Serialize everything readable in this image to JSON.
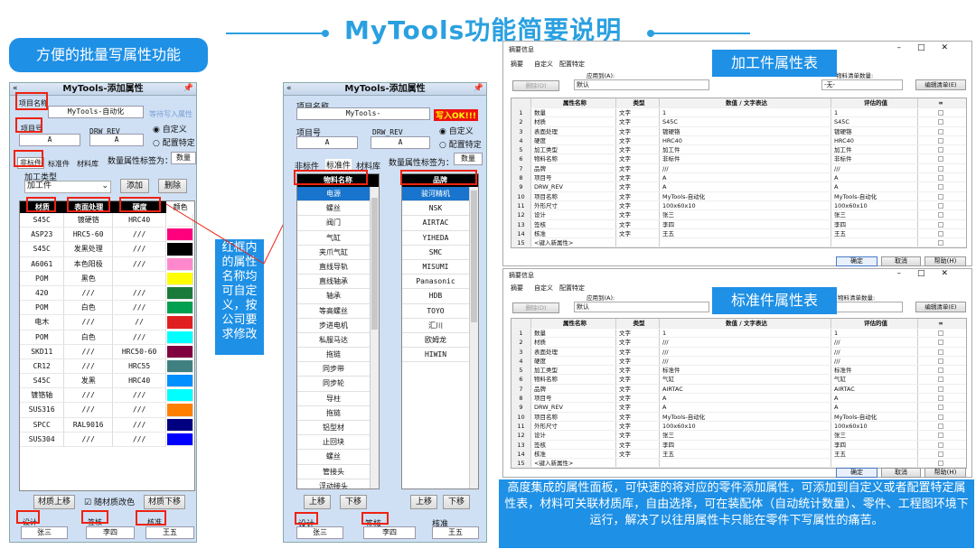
{
  "page_title": "MyTools功能简要说明",
  "left_badge": "方便的批量写属性功能",
  "callout": "红框内的属性名称均可自定义，按公司要求修改",
  "bottom_text": "高度集成的属性面板，可快速的将对应的零件添加属性，可添加到自定义或者配置特定属性表，材料可关联材质库，自由选择，可在装配体（自动统计数量）、零件、工程图环境下运行，解决了以往用属性卡只能在零件下写属性的痛苦。",
  "panel1": {
    "title": "MyTools-添加属性",
    "name_label": "项目名称",
    "name_value": "MyTools-自动化",
    "write_hint": "等待写入属性",
    "num_label": "项目号",
    "num_value": "A",
    "drw_label": "DRW_REV",
    "drw_value": "A",
    "radio_custom": "自定义",
    "radio_config": "配置特定",
    "tabs": [
      "非标件",
      "标准件",
      "材料库"
    ],
    "qty_label": "数量属性标签为：",
    "qty_value": "数量",
    "type_label": "加工类型",
    "type_value": "加工件",
    "add_btn": "添加",
    "del_btn": "删除",
    "cols": [
      "材质",
      "表面处理",
      "硬度",
      "颜色"
    ],
    "rows": [
      [
        "S45C",
        "镀硬铬",
        "HRC40",
        "#ffffff"
      ],
      [
        "ASP23",
        "HRC5-60",
        "///",
        "#ff007f"
      ],
      [
        "S45C",
        "发黑处理",
        "///",
        "#000000"
      ],
      [
        "A6061",
        "本色阳极",
        "///",
        "#ff88cc"
      ],
      [
        "POM",
        "黑色",
        "",
        "#ffff00"
      ],
      [
        "420",
        "///",
        "///",
        "#1a7a3a"
      ],
      [
        "POM",
        "白色",
        "///",
        "#00a050"
      ],
      [
        "电木",
        "///",
        "//",
        "#e02020"
      ],
      [
        "POM",
        "白色",
        "///",
        "#00ffff"
      ],
      [
        "SKD11",
        "///",
        "HRC50-60",
        "#800040"
      ],
      [
        "CR12",
        "///",
        "HRC55",
        "#408080"
      ],
      [
        "S45C",
        "发黑",
        "HRC40",
        "#0090ff"
      ],
      [
        "镀铬轴",
        "///",
        "///",
        "#00ffff"
      ],
      [
        "SUS316",
        "///",
        "///",
        "#ff8000"
      ],
      [
        "SPCC",
        "RAL9016",
        "///",
        "#000080"
      ],
      [
        "SUS304",
        "///",
        "///",
        "#0000ff"
      ]
    ],
    "mat_up": "材质上移",
    "follow": "随材质改色",
    "mat_down": "材质下移",
    "design_label": "设计",
    "design_value": "张三",
    "check_label": "签核",
    "check_value": "李四",
    "std_label": "核准",
    "std_value": "王五"
  },
  "panel2": {
    "title": "MyTools-添加属性",
    "name_label": "项目名称",
    "name_value": "MyTools-",
    "write_ok": "写入OK!!!",
    "num_label": "项目号",
    "num_value": "A",
    "drw_label": "DRW_REV",
    "drw_value": "A",
    "radio_custom": "自定义",
    "radio_config": "配置特定",
    "tabs": [
      "非标件",
      "标准件",
      "材料库"
    ],
    "qty_label": "数量属性标签为：",
    "qty_value": "数量",
    "col_a": "物料名称",
    "col_b": "品牌",
    "items": [
      "电源",
      "螺丝",
      "阀门",
      "气缸",
      "夹爪气缸",
      "直线导轨",
      "直线轴承",
      "轴承",
      "等高螺丝",
      "步进电机",
      "私服马达",
      "拖链",
      "同步带",
      "同步轮",
      "导柱",
      "拖链",
      "铝型材",
      "止回块",
      "螺丝",
      "管接头",
      "浮动接头"
    ],
    "brands": [
      "骏河精机",
      "NSK",
      "AIRTAC",
      "YIHEDA",
      "SMC",
      "MISUMI",
      "Panasonic",
      "HDB",
      "TOYO",
      "汇川",
      "欧姆龙",
      "HIWIN"
    ],
    "up_btn": "上移",
    "down_btn": "下移",
    "design_label": "设计",
    "design_value": "张三",
    "check_label": "签核",
    "check_value": "李四",
    "std_label": "核准",
    "std_value": "王五"
  },
  "dialog1": {
    "title": "摘要信息",
    "badge": "加工件属性表",
    "tabs": [
      "摘要",
      "自定义",
      "配置特定"
    ],
    "apply_label": "应用到(A):",
    "apply_value": "默认",
    "delete_btn": "删除(D)",
    "bom_label": "物料清单数量:",
    "bom_value": "-无-",
    "edit_btn": "编辑清单(E)",
    "cols": [
      "",
      "属性名称",
      "类型",
      "数值 / 文字表达",
      "评估的值",
      "∞"
    ],
    "rows": [
      [
        "1",
        "数量",
        "文字",
        "1",
        "1"
      ],
      [
        "2",
        "材质",
        "文字",
        "S45C",
        "S45C"
      ],
      [
        "3",
        "表面处理",
        "文字",
        "镀硬铬",
        "镀硬铬"
      ],
      [
        "4",
        "硬度",
        "文字",
        "HRC40",
        "HRC40"
      ],
      [
        "5",
        "加工类型",
        "文字",
        "加工件",
        "加工件"
      ],
      [
        "6",
        "物料名称",
        "文字",
        "非标件",
        "非标件"
      ],
      [
        "7",
        "品牌",
        "文字",
        "///",
        "///"
      ],
      [
        "8",
        "项目号",
        "文字",
        "A",
        "A"
      ],
      [
        "9",
        "DRW_REV",
        "文字",
        "A",
        "A"
      ],
      [
        "10",
        "项目名称",
        "文字",
        "MyTools-自动化",
        "MyTools-自动化"
      ],
      [
        "11",
        "外形尺寸",
        "文字",
        "100x60x10",
        "100x60x10"
      ],
      [
        "12",
        "设计",
        "文字",
        "张三",
        "张三"
      ],
      [
        "13",
        "签核",
        "文字",
        "李四",
        "李四"
      ],
      [
        "14",
        "核准",
        "文字",
        "王五",
        "王五"
      ],
      [
        "15",
        "<键入新属性>",
        "",
        "",
        ""
      ]
    ],
    "ok": "确定",
    "cancel": "取消",
    "help": "帮助(H)"
  },
  "dialog2": {
    "title": "摘要信息",
    "badge": "标准件属性表",
    "tabs": [
      "摘要",
      "自定义",
      "配置特定"
    ],
    "apply_label": "应用到(A):",
    "apply_value": "默认",
    "delete_btn": "删除(D)",
    "bom_label": "物料清单数量:",
    "edit_btn": "编辑清单(E)",
    "cols": [
      "",
      "属性名称",
      "类型",
      "数值 / 文字表达",
      "评估的值",
      "∞"
    ],
    "rows": [
      [
        "1",
        "数量",
        "文字",
        "1",
        "1"
      ],
      [
        "2",
        "材质",
        "文字",
        "///",
        "///"
      ],
      [
        "3",
        "表面处理",
        "文字",
        "///",
        "///"
      ],
      [
        "4",
        "硬度",
        "文字",
        "///",
        "///"
      ],
      [
        "5",
        "加工类型",
        "文字",
        "标准件",
        "标准件"
      ],
      [
        "6",
        "物料名称",
        "文字",
        "气缸",
        "气缸"
      ],
      [
        "7",
        "品牌",
        "文字",
        "AIRTAC",
        "AIRTAC"
      ],
      [
        "8",
        "项目号",
        "文字",
        "A",
        "A"
      ],
      [
        "9",
        "DRW_REV",
        "文字",
        "A",
        "A"
      ],
      [
        "10",
        "项目名称",
        "文字",
        "MyTools-自动化",
        "MyTools-自动化"
      ],
      [
        "11",
        "外形尺寸",
        "文字",
        "100x60x10",
        "100x60x10"
      ],
      [
        "12",
        "设计",
        "文字",
        "张三",
        "张三"
      ],
      [
        "13",
        "签核",
        "文字",
        "李四",
        "李四"
      ],
      [
        "14",
        "核准",
        "文字",
        "王五",
        "王五"
      ],
      [
        "15",
        "<键入新属性>",
        "",
        "",
        ""
      ]
    ],
    "ok": "确定",
    "cancel": "取消",
    "help": "帮助(H)"
  }
}
